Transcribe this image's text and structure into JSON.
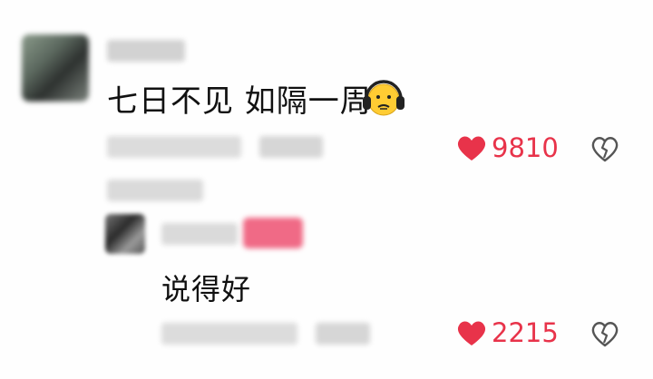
{
  "comment": {
    "text": "七日不见 如隔一周",
    "emoji": "headphone-emoji",
    "likes": "9810"
  },
  "reply": {
    "text": "说得好",
    "likes": "2215"
  },
  "colors": {
    "like": "#e8334a",
    "text": "#111111",
    "blur": "#d8d8d8",
    "author_tag": "#f06a86",
    "dislike_icon": "#555555"
  },
  "icons": [
    "heart-icon",
    "broken-heart-icon",
    "headphone-emoji"
  ]
}
